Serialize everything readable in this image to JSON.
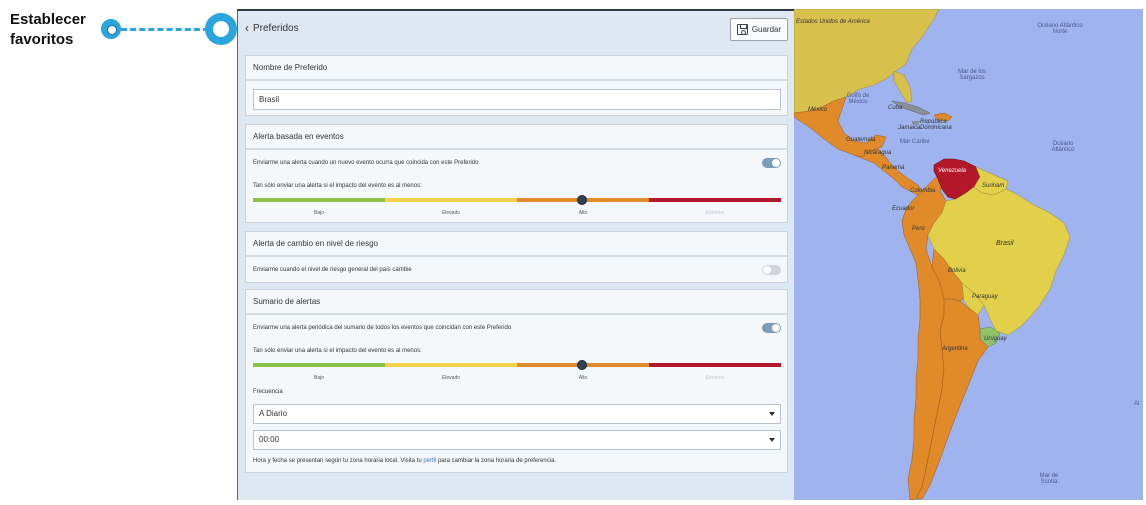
{
  "callout": {
    "label": "Establecer favoritos"
  },
  "header": {
    "back_label": "Preferidos",
    "save_label": "Guardar"
  },
  "name_section": {
    "title": "Nombre de Preferido",
    "value": "Brasil"
  },
  "event_alert": {
    "title": "Alerta basada en eventos",
    "toggle_label": "Enviarme una alerta cuando un nuevo evento ocurra que coincida con este Preferido",
    "toggle_on": true,
    "impact_label": "Tan sólo enviar una alerta si el impacto del evento es al menos:",
    "levels": [
      "Bajo",
      "Elevado",
      "Alto",
      "Extremo"
    ],
    "selected_level": "Alto"
  },
  "risk_alert": {
    "title": "Alerta de cambio en nivel de riesgo",
    "toggle_label": "Enviarme cuando el nivel de riesgo general del país cambie",
    "toggle_on": false
  },
  "summary": {
    "title": "Sumario de alertas",
    "toggle_label": "Enviarme una alerta periódica del sumario de todos los eventos que coincidan con este Preferido",
    "toggle_on": true,
    "impact_label": "Tan sólo enviar una alerta si el impacto del evento es al menos:",
    "levels": [
      "Bajo",
      "Elevado",
      "Alto",
      "Extremo"
    ],
    "selected_level": "Alto",
    "frequency_label": "Frecuencia",
    "frequency_value": "A Diario",
    "time_value": "00:00",
    "footnote_before": "Hora y fecha se presentan según tu zona horaria local. Visita tu ",
    "footnote_link": "perfil",
    "footnote_after": " para cambiar la zona horaria de preferencia."
  },
  "colors": {
    "low": "#8bc34a",
    "elevated": "#f2d24b",
    "high": "#e08a2a",
    "extreme": "#b3182a",
    "accent": "#2aa5dd",
    "link": "#3a7bd5"
  },
  "map": {
    "labels": {
      "usa": "Estados Unidos de América",
      "ocean_north": "Océano Atlántico Norte",
      "sargasso": "Mar de los Sargazos",
      "gulf": "Golfo de México",
      "mexico": "México",
      "cuba": "Cuba",
      "jamaica": "Jamaica",
      "dominican": "República Dominicana",
      "guatemala": "Guatemala",
      "caribbean": "Mar Caribe",
      "nicaragua": "Nicaragua",
      "panama": "Panamá",
      "venezuela": "Venezuela",
      "ocean_atlantic": "Océano Atlántico",
      "colombia": "Colombia",
      "suriname": "Surinam",
      "ecuador": "Ecuador",
      "peru": "Perú",
      "brazil": "Brasil",
      "bolivia": "Bolivia",
      "paraguay": "Paraguay",
      "uruguay": "Uruguay",
      "argentina": "Argentina",
      "scotia": "Mar de Scotia",
      "edge_at": "At"
    }
  }
}
